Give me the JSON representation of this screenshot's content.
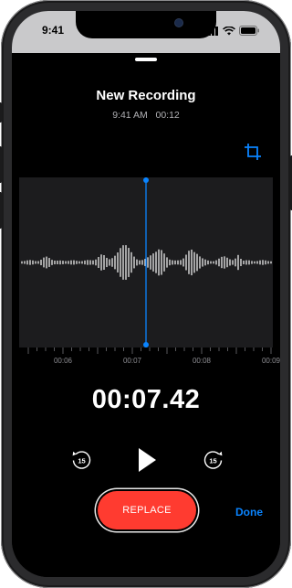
{
  "status_bar": {
    "time": "9:41"
  },
  "recording": {
    "title": "New Recording",
    "date_time": "9:41 AM",
    "duration": "00:12"
  },
  "timeline": {
    "labels": [
      "00:06",
      "00:07",
      "00:08",
      "00:09"
    ],
    "playhead_position": 0.5
  },
  "playback": {
    "elapsed": "00:07.42",
    "skip_back_seconds": "15",
    "skip_forward_seconds": "15"
  },
  "actions": {
    "replace_label": "REPLACE",
    "done_label": "Done"
  },
  "colors": {
    "accent": "#0a84ff",
    "record": "#ff3b30",
    "waveform": "#ffffff"
  },
  "icons": [
    "crop-icon",
    "skip-back-15-icon",
    "play-icon",
    "skip-forward-15-icon"
  ]
}
